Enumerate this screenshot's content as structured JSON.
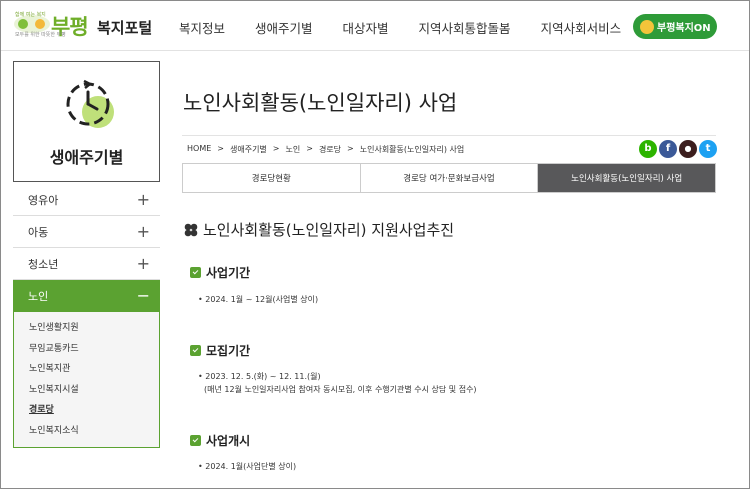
{
  "header": {
    "logo_top_small": "함께 여는 복지",
    "logo_mark": "부평",
    "logo_bottom_small": "모두를 위한 따뜻한 부평",
    "logo_name": "복지포털",
    "nav": [
      "복지정보",
      "생애주기별",
      "대상자별",
      "지역사회통합돌봄",
      "지역사회서비스"
    ],
    "cta_label": "부평복지ON"
  },
  "sidebar": {
    "title": "생애주기별",
    "items": [
      {
        "label": "영유아",
        "toggle": "+"
      },
      {
        "label": "아동",
        "toggle": "+"
      },
      {
        "label": "청소년",
        "toggle": "+"
      },
      {
        "label": "노인",
        "toggle": "−"
      }
    ],
    "sub_items": [
      "노인생활지원",
      "무임교통카드",
      "노인복지관",
      "노인복지시설",
      "경로당",
      "노인복지소식"
    ]
  },
  "main": {
    "title": "노인사회활동(노인일자리) 사업",
    "breadcrumb": [
      "HOME",
      "생애주기별",
      "노인",
      "경로당",
      "노인사회활동(노인일자리) 사업"
    ],
    "breadcrumb_sep": ">",
    "share": [
      {
        "icon": "blog-icon",
        "glyph": "b",
        "color": "#2db400"
      },
      {
        "icon": "facebook-icon",
        "glyph": "f",
        "color": "#3b5998"
      },
      {
        "icon": "kakao-icon",
        "glyph": "●",
        "color": "#3c1e1e"
      },
      {
        "icon": "twitter-icon",
        "glyph": "t",
        "color": "#1da1f2"
      }
    ],
    "tabs": [
      "경로당현황",
      "경로당 여가·문화보급사업",
      "노인사회활동(노인일자리) 사업"
    ],
    "section_title": "노인사회활동(노인일자리) 지원사업추진",
    "blocks": [
      {
        "head": "사업기간",
        "lines": [
          "• 2024. 1월 ~ 12월(사업별 상이)"
        ]
      },
      {
        "head": "모집기간",
        "lines": [
          "• 2023. 12. 5.(화) ~ 12. 11.(월)",
          "(매년 12월 노인일자리사업 참여자 동시모집, 이후 수행기관별 수시 상담 및 접수)"
        ]
      },
      {
        "head": "사업개시",
        "lines": [
          "• 2024. 1월(사업단별 상이)"
        ]
      }
    ]
  },
  "colors": {
    "accent_green": "#5ba231",
    "active_tab": "#58585a"
  }
}
